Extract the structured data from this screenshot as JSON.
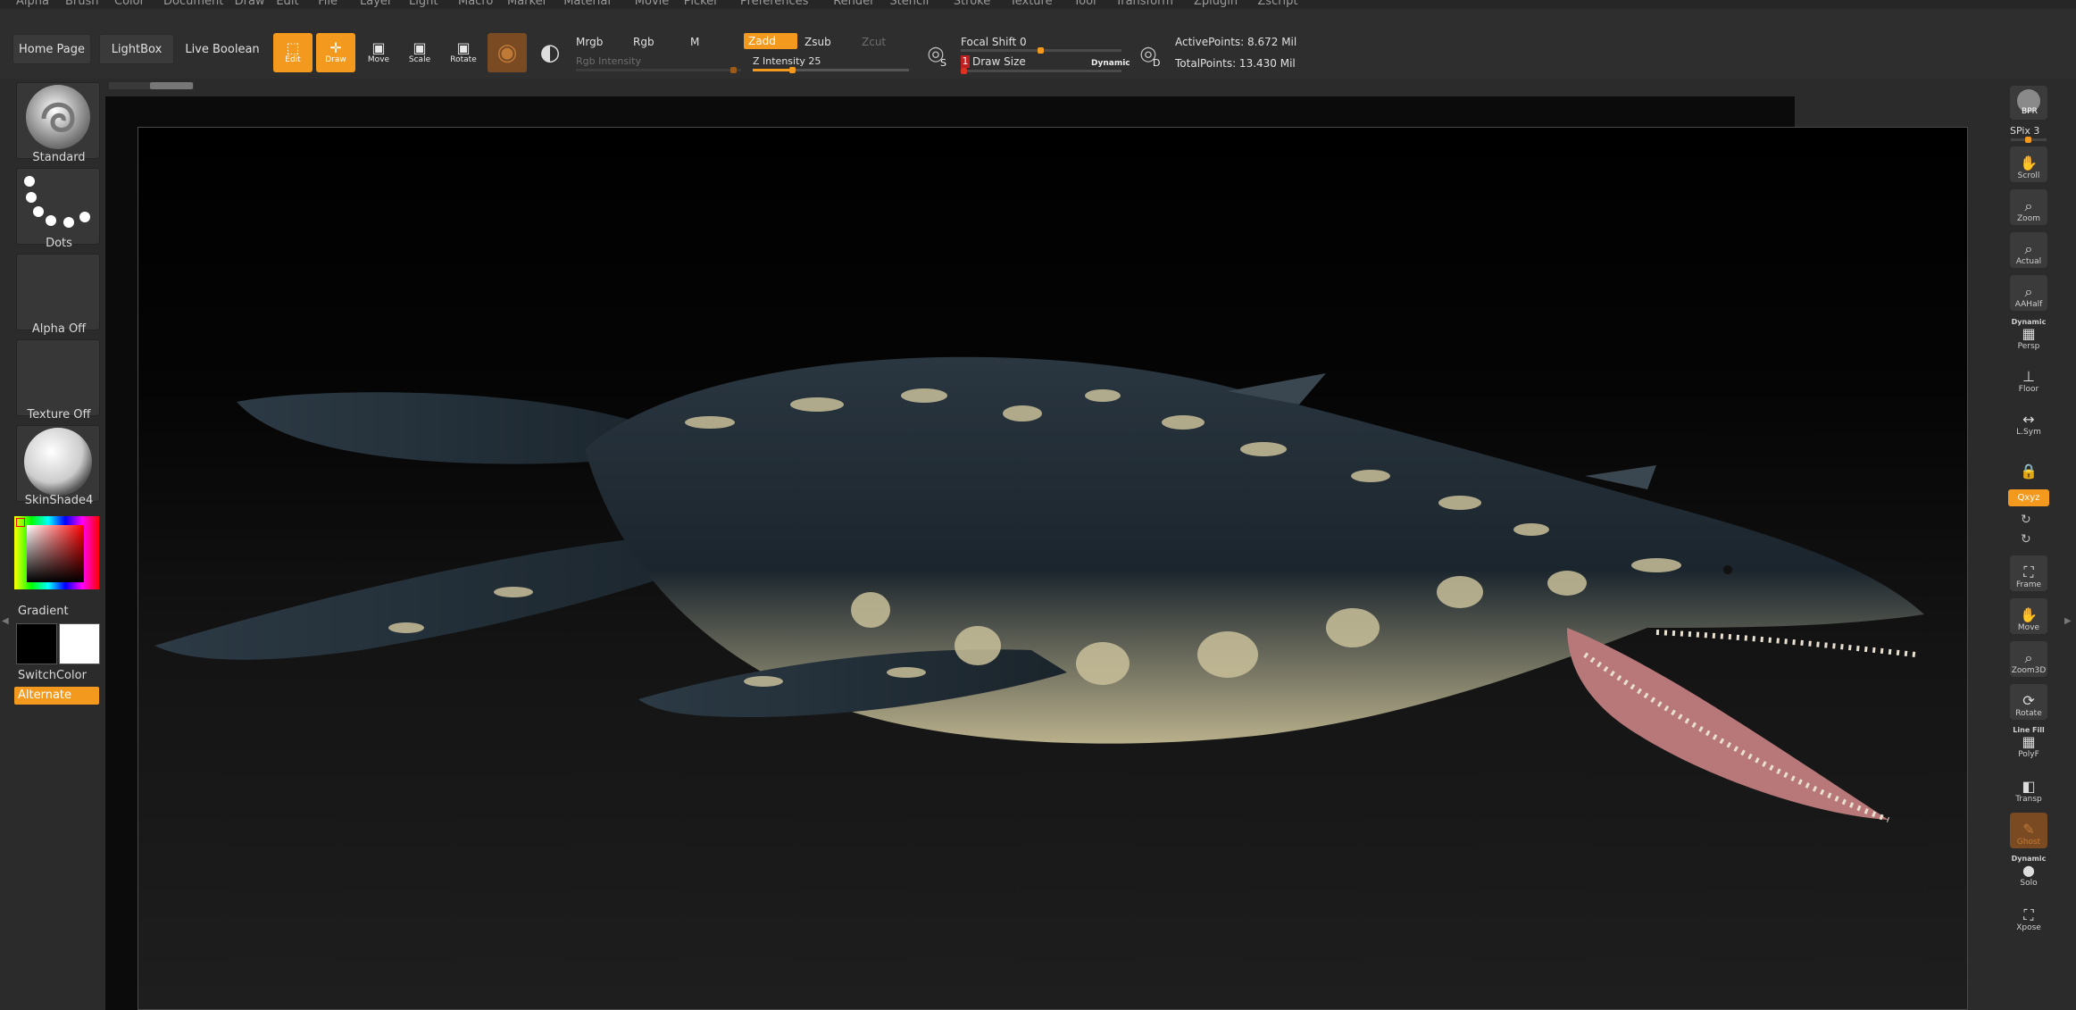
{
  "menu": [
    "Alpha",
    "Brush",
    "Color",
    "Document",
    "Draw",
    "Edit",
    "File",
    "Layer",
    "Light",
    "Macro",
    "Marker",
    "Material",
    "Movie",
    "Picker",
    "Preferences",
    "Render",
    "Stencil",
    "Stroke",
    "Texture",
    "Tool",
    "Transform",
    "Zplugin",
    "Zscript"
  ],
  "shelf": {
    "home_page": "Home Page",
    "lightbox": "LightBox",
    "live_boolean": "Live Boolean",
    "edit": "Edit",
    "draw": "Draw",
    "move": "Move",
    "scale": "Scale",
    "rotate": "Rotate",
    "mrgb": "Mrgb",
    "rgb": "Rgb",
    "m": "M",
    "zadd": "Zadd",
    "zsub": "Zsub",
    "zcut": "Zcut",
    "rgb_intensity": "Rgb Intensity",
    "z_intensity_label": "Z Intensity",
    "z_intensity_value": "25",
    "z_intensity_fraction": 0.25,
    "focal_shift_label": "Focal Shift",
    "focal_shift_value": "0",
    "draw_size_label": "Draw Size",
    "draw_size_value": "1",
    "dynamic": "Dynamic",
    "s_letter": "S",
    "d_letter": "D",
    "active_points": "ActivePoints: 8.672 Mil",
    "total_points": "TotalPoints: 13.430 Mil"
  },
  "left_tray": {
    "brush": "Standard",
    "stroke": "Dots",
    "alpha": "Alpha Off",
    "texture": "Texture Off",
    "material": "SkinShade4",
    "gradient": "Gradient",
    "switch_color": "SwitchColor",
    "alternate": "Alternate"
  },
  "right_tray": {
    "bpr": "BPR",
    "spix": "SPix 3",
    "buttons": [
      "Scroll",
      "Zoom",
      "Actual",
      "AAHalf",
      "Persp",
      "Floor",
      "L.Sym",
      "",
      "Frame",
      "Move",
      "Zoom3D",
      "Rotate",
      "PolyF",
      "Transp",
      "Ghost",
      "Solo",
      "Xpose"
    ],
    "dynamic": "Dynamic",
    "line_fill": "Line Fill",
    "xyz": "Qxyz"
  },
  "colors": {
    "accent": "#f39a1e",
    "panel": "#2e2e2e",
    "canvas": "#000000",
    "creature_dark": "#1f2a33",
    "creature_pattern": "#c9c09a",
    "mouth": "#b8787a"
  }
}
